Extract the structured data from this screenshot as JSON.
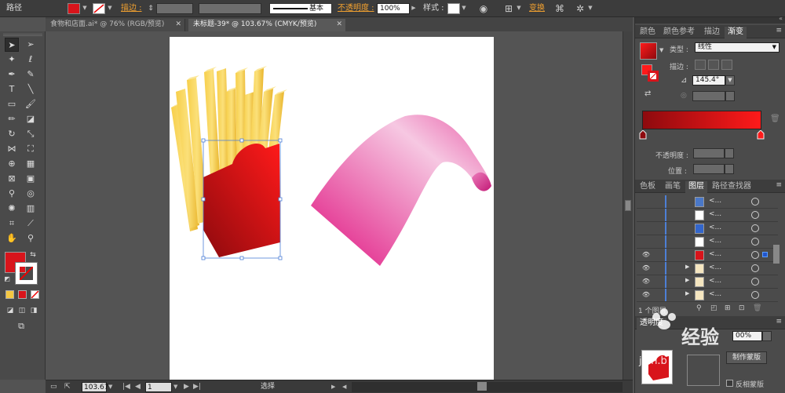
{
  "control_bar": {
    "object_type": "路径",
    "fill_color": "#d8141b",
    "stroke_label": "描边 :",
    "stroke_style": "基本",
    "opacity_label": "不透明度 :",
    "opacity_value": "100%",
    "style_label": "样式 :",
    "transform_label": "变换"
  },
  "tabs": [
    {
      "label": "食物和店面.ai* @ 76% (RGB/预览)"
    },
    {
      "label": "未标题-39* @ 103.67% (CMYK/预览)"
    }
  ],
  "toolbox": {
    "fill_color": "#d8141b",
    "small_swatches": [
      "#f5c842",
      "#d8141b",
      "#ffffff"
    ]
  },
  "status_bar": {
    "zoom": "103.67",
    "page": "1",
    "tool_name": "选择"
  },
  "gradient_panel": {
    "tabs": [
      "颜色",
      "颜色参考",
      "描边",
      "渐变"
    ],
    "active_tab": "渐变",
    "type_label": "类型 :",
    "type_value": "线性",
    "stroke_label": "描边 :",
    "angle_value": "145.4°",
    "opacity_label": "不透明度 :",
    "position_label": "位置 :",
    "gradient_start": "#8e0a0e",
    "gradient_end": "#ff1a1a"
  },
  "layers_panel": {
    "tabs": [
      "色板",
      "画笔",
      "图层",
      "路径查找器"
    ],
    "active_tab": "图层",
    "layer_count": "1 个图层",
    "rows": [
      {
        "name": "<...",
        "visible": false,
        "has_arrow": false,
        "thumb_color": "#4a78c8"
      },
      {
        "name": "<...",
        "visible": false,
        "has_arrow": false,
        "thumb_color": "#ffffff"
      },
      {
        "name": "<...",
        "visible": false,
        "has_arrow": false,
        "thumb_color": "#3366cc"
      },
      {
        "name": "<...",
        "visible": false,
        "has_arrow": false,
        "thumb_color": "#ffffff"
      },
      {
        "name": "<...",
        "visible": true,
        "has_arrow": false,
        "thumb_color": "#d8141b"
      },
      {
        "name": "<...",
        "visible": true,
        "has_arrow": true,
        "thumb_color": "#f5e6c0"
      },
      {
        "name": "<...",
        "visible": true,
        "has_arrow": true,
        "thumb_color": "#f5e6c0"
      },
      {
        "name": "<...",
        "visible": true,
        "has_arrow": true,
        "thumb_color": "#f5e6c0"
      }
    ]
  },
  "transparency_panel": {
    "title": "透明度",
    "opacity_value": "00%",
    "make_mask_button": "制作蒙版",
    "invert_mask_label": "反相蒙版"
  },
  "watermark": {
    "main": "经验",
    "sub": "jian.b"
  }
}
